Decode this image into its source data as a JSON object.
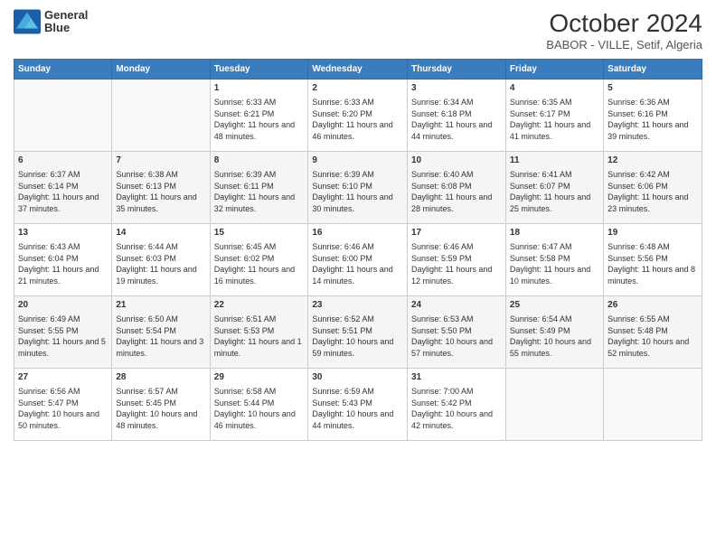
{
  "logo": {
    "line1": "General",
    "line2": "Blue"
  },
  "title": "October 2024",
  "location": "BABOR - VILLE, Setif, Algeria",
  "days_of_week": [
    "Sunday",
    "Monday",
    "Tuesday",
    "Wednesday",
    "Thursday",
    "Friday",
    "Saturday"
  ],
  "weeks": [
    [
      {
        "day": "",
        "sunrise": "",
        "sunset": "",
        "daylight": ""
      },
      {
        "day": "",
        "sunrise": "",
        "sunset": "",
        "daylight": ""
      },
      {
        "day": "1",
        "sunrise": "Sunrise: 6:33 AM",
        "sunset": "Sunset: 6:21 PM",
        "daylight": "Daylight: 11 hours and 48 minutes."
      },
      {
        "day": "2",
        "sunrise": "Sunrise: 6:33 AM",
        "sunset": "Sunset: 6:20 PM",
        "daylight": "Daylight: 11 hours and 46 minutes."
      },
      {
        "day": "3",
        "sunrise": "Sunrise: 6:34 AM",
        "sunset": "Sunset: 6:18 PM",
        "daylight": "Daylight: 11 hours and 44 minutes."
      },
      {
        "day": "4",
        "sunrise": "Sunrise: 6:35 AM",
        "sunset": "Sunset: 6:17 PM",
        "daylight": "Daylight: 11 hours and 41 minutes."
      },
      {
        "day": "5",
        "sunrise": "Sunrise: 6:36 AM",
        "sunset": "Sunset: 6:16 PM",
        "daylight": "Daylight: 11 hours and 39 minutes."
      }
    ],
    [
      {
        "day": "6",
        "sunrise": "Sunrise: 6:37 AM",
        "sunset": "Sunset: 6:14 PM",
        "daylight": "Daylight: 11 hours and 37 minutes."
      },
      {
        "day": "7",
        "sunrise": "Sunrise: 6:38 AM",
        "sunset": "Sunset: 6:13 PM",
        "daylight": "Daylight: 11 hours and 35 minutes."
      },
      {
        "day": "8",
        "sunrise": "Sunrise: 6:39 AM",
        "sunset": "Sunset: 6:11 PM",
        "daylight": "Daylight: 11 hours and 32 minutes."
      },
      {
        "day": "9",
        "sunrise": "Sunrise: 6:39 AM",
        "sunset": "Sunset: 6:10 PM",
        "daylight": "Daylight: 11 hours and 30 minutes."
      },
      {
        "day": "10",
        "sunrise": "Sunrise: 6:40 AM",
        "sunset": "Sunset: 6:08 PM",
        "daylight": "Daylight: 11 hours and 28 minutes."
      },
      {
        "day": "11",
        "sunrise": "Sunrise: 6:41 AM",
        "sunset": "Sunset: 6:07 PM",
        "daylight": "Daylight: 11 hours and 25 minutes."
      },
      {
        "day": "12",
        "sunrise": "Sunrise: 6:42 AM",
        "sunset": "Sunset: 6:06 PM",
        "daylight": "Daylight: 11 hours and 23 minutes."
      }
    ],
    [
      {
        "day": "13",
        "sunrise": "Sunrise: 6:43 AM",
        "sunset": "Sunset: 6:04 PM",
        "daylight": "Daylight: 11 hours and 21 minutes."
      },
      {
        "day": "14",
        "sunrise": "Sunrise: 6:44 AM",
        "sunset": "Sunset: 6:03 PM",
        "daylight": "Daylight: 11 hours and 19 minutes."
      },
      {
        "day": "15",
        "sunrise": "Sunrise: 6:45 AM",
        "sunset": "Sunset: 6:02 PM",
        "daylight": "Daylight: 11 hours and 16 minutes."
      },
      {
        "day": "16",
        "sunrise": "Sunrise: 6:46 AM",
        "sunset": "Sunset: 6:00 PM",
        "daylight": "Daylight: 11 hours and 14 minutes."
      },
      {
        "day": "17",
        "sunrise": "Sunrise: 6:46 AM",
        "sunset": "Sunset: 5:59 PM",
        "daylight": "Daylight: 11 hours and 12 minutes."
      },
      {
        "day": "18",
        "sunrise": "Sunrise: 6:47 AM",
        "sunset": "Sunset: 5:58 PM",
        "daylight": "Daylight: 11 hours and 10 minutes."
      },
      {
        "day": "19",
        "sunrise": "Sunrise: 6:48 AM",
        "sunset": "Sunset: 5:56 PM",
        "daylight": "Daylight: 11 hours and 8 minutes."
      }
    ],
    [
      {
        "day": "20",
        "sunrise": "Sunrise: 6:49 AM",
        "sunset": "Sunset: 5:55 PM",
        "daylight": "Daylight: 11 hours and 5 minutes."
      },
      {
        "day": "21",
        "sunrise": "Sunrise: 6:50 AM",
        "sunset": "Sunset: 5:54 PM",
        "daylight": "Daylight: 11 hours and 3 minutes."
      },
      {
        "day": "22",
        "sunrise": "Sunrise: 6:51 AM",
        "sunset": "Sunset: 5:53 PM",
        "daylight": "Daylight: 11 hours and 1 minute."
      },
      {
        "day": "23",
        "sunrise": "Sunrise: 6:52 AM",
        "sunset": "Sunset: 5:51 PM",
        "daylight": "Daylight: 10 hours and 59 minutes."
      },
      {
        "day": "24",
        "sunrise": "Sunrise: 6:53 AM",
        "sunset": "Sunset: 5:50 PM",
        "daylight": "Daylight: 10 hours and 57 minutes."
      },
      {
        "day": "25",
        "sunrise": "Sunrise: 6:54 AM",
        "sunset": "Sunset: 5:49 PM",
        "daylight": "Daylight: 10 hours and 55 minutes."
      },
      {
        "day": "26",
        "sunrise": "Sunrise: 6:55 AM",
        "sunset": "Sunset: 5:48 PM",
        "daylight": "Daylight: 10 hours and 52 minutes."
      }
    ],
    [
      {
        "day": "27",
        "sunrise": "Sunrise: 6:56 AM",
        "sunset": "Sunset: 5:47 PM",
        "daylight": "Daylight: 10 hours and 50 minutes."
      },
      {
        "day": "28",
        "sunrise": "Sunrise: 6:57 AM",
        "sunset": "Sunset: 5:45 PM",
        "daylight": "Daylight: 10 hours and 48 minutes."
      },
      {
        "day": "29",
        "sunrise": "Sunrise: 6:58 AM",
        "sunset": "Sunset: 5:44 PM",
        "daylight": "Daylight: 10 hours and 46 minutes."
      },
      {
        "day": "30",
        "sunrise": "Sunrise: 6:59 AM",
        "sunset": "Sunset: 5:43 PM",
        "daylight": "Daylight: 10 hours and 44 minutes."
      },
      {
        "day": "31",
        "sunrise": "Sunrise: 7:00 AM",
        "sunset": "Sunset: 5:42 PM",
        "daylight": "Daylight: 10 hours and 42 minutes."
      },
      {
        "day": "",
        "sunrise": "",
        "sunset": "",
        "daylight": ""
      },
      {
        "day": "",
        "sunrise": "",
        "sunset": "",
        "daylight": ""
      }
    ]
  ]
}
